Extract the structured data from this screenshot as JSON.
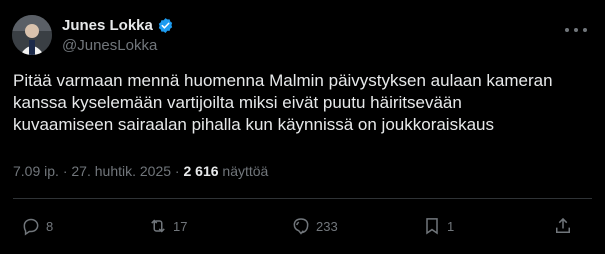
{
  "author": {
    "display_name": "Junes Lokka",
    "handle": "@JunesLokka",
    "verified_color": "#1d9bf0"
  },
  "tweet": {
    "text": "Pitää varmaan mennä huomenna Malmin päivystyksen aulaan kameran\nkanssa kyselemään vartijoilta miksi eivät puutu häiritsevään\nkuvaamiseen sairaalan pihalla kun käynnissä on joukkoraiskaus",
    "time": "7.09 ip.",
    "separator": "·",
    "date": "27. huhtik. 2025",
    "views_count": "2 616",
    "views_label": "näyttöä"
  },
  "actions": {
    "replies": "8",
    "reposts": "17",
    "views": "233",
    "bookmarks": "1"
  },
  "icons": {
    "reply": "reply-icon",
    "repost": "repost-icon",
    "views": "views-icon",
    "bookmark": "bookmark-icon",
    "share": "share-icon",
    "more": "more-icon"
  }
}
